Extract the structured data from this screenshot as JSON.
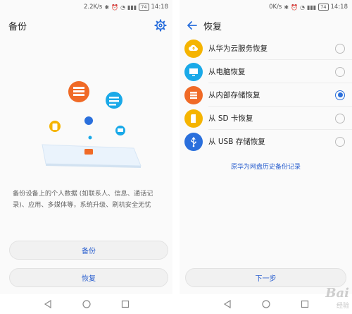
{
  "left": {
    "status": {
      "speed": "2.2K/s",
      "battery": "74",
      "time": "14:18"
    },
    "title": "备份",
    "description": "备份设备上的个人数据 (如联系人、信息、通话记录)、应用、多媒体等，系统升级、刷机安全无忧",
    "backup_label": "备份",
    "restore_label": "恢复"
  },
  "right": {
    "status": {
      "speed": "0K/s",
      "battery": "74",
      "time": "14:18"
    },
    "title": "恢复",
    "options": [
      {
        "label": "从华为云服务恢复",
        "icon": "cloud-icon",
        "color": "#f5b400",
        "checked": false
      },
      {
        "label": "从电脑恢复",
        "icon": "monitor-icon",
        "color": "#1aa9e8",
        "checked": false
      },
      {
        "label": "从内部存储恢复",
        "icon": "storage-icon",
        "color": "#f06a26",
        "checked": true
      },
      {
        "label": "从 SD 卡恢复",
        "icon": "sd-card-icon",
        "color": "#f5b400",
        "checked": false
      },
      {
        "label": "从 USB 存储恢复",
        "icon": "usb-icon",
        "color": "#2a6fdc",
        "checked": false
      }
    ],
    "history_link": "原华为网盘历史备份记录",
    "next_label": "下一步"
  },
  "watermark": {
    "text": "Bai",
    "sub": "经验"
  }
}
